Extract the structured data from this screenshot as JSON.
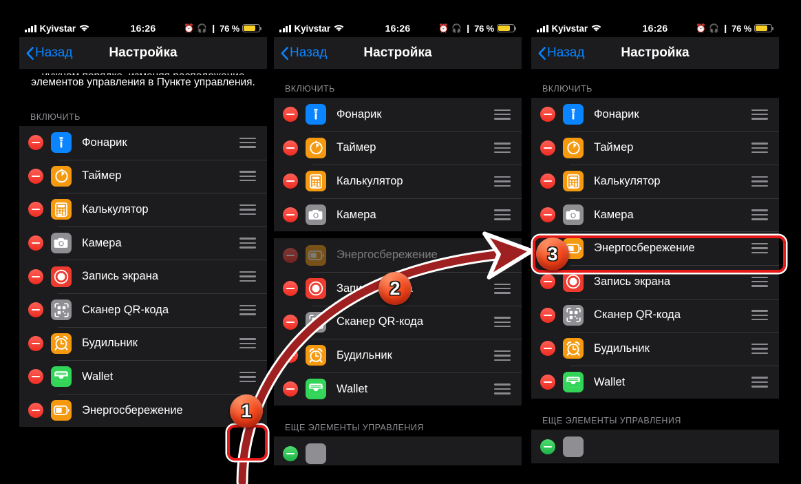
{
  "statusbar": {
    "carrier": "Kyivstar",
    "time": "16:26",
    "alarm_glyph": "⏰",
    "headphones_glyph": "🎧",
    "lock_glyph": "❙",
    "battery_percent": "76 %",
    "battery_level": 76,
    "wifi_icon": "wifi-icon",
    "signal_icon": "cellular-signal-icon"
  },
  "navbar": {
    "back_label": "Назад",
    "title": "Настройка",
    "back_icon": "chevron-left-icon",
    "accent_color": "#0a84ff"
  },
  "panel1": {
    "hint_line_cut": "нужном порядке, изменяя расположение",
    "hint_line1": "элементов управления в Пункте",
    "hint_line2": "управления.",
    "section_header": "ВКЛЮЧИТЬ"
  },
  "panel2": {
    "section_header": "ВКЛЮЧИТЬ",
    "more_header": "ЕЩЕ ЭЛЕМЕНТЫ УПРАВЛЕНИЯ"
  },
  "panel3": {
    "section_header": "ВКЛЮЧИТЬ",
    "more_header": "ЕЩЕ ЭЛЕМЕНТЫ УПРАВЛЕНИЯ"
  },
  "rows_panel1": [
    {
      "label": "Фонарик",
      "icon": "flashlight-icon",
      "color": "#0a84ff"
    },
    {
      "label": "Таймер",
      "icon": "timer-icon",
      "color": "#f59a10"
    },
    {
      "label": "Калькулятор",
      "icon": "calculator-icon",
      "color": "#f59a10"
    },
    {
      "label": "Камера",
      "icon": "camera-icon",
      "color": "#8e8e93"
    },
    {
      "label": "Запись экрана",
      "icon": "screenrecord-icon",
      "color": "#ee3b30"
    },
    {
      "label": "Сканер QR-кода",
      "icon": "qrscanner-icon",
      "color": "#8e8e93"
    },
    {
      "label": "Будильник",
      "icon": "alarm-icon",
      "color": "#f59a10"
    },
    {
      "label": "Wallet",
      "icon": "wallet-icon",
      "color": "#32d558"
    },
    {
      "label": "Энергосбережение",
      "icon": "lowpower-icon",
      "color": "#f59a10"
    }
  ],
  "rows_panel2": [
    {
      "label": "Фонарик",
      "icon": "flashlight-icon",
      "color": "#0a84ff",
      "dragging": false
    },
    {
      "label": "Таймер",
      "icon": "timer-icon",
      "color": "#f59a10",
      "dragging": false
    },
    {
      "label": "Калькулятор",
      "icon": "calculator-icon",
      "color": "#f59a10",
      "dragging": false
    },
    {
      "label": "Камера",
      "icon": "camera-icon",
      "color": "#8e8e93",
      "dragging": false
    },
    {
      "label": "Энергосбережение",
      "icon": "lowpower-icon",
      "color": "#f59a10",
      "dragging": true
    },
    {
      "label": "Запись экрана",
      "icon": "screenrecord-icon",
      "color": "#ee3b30",
      "dragging": false
    },
    {
      "label": "Сканер QR-кода",
      "icon": "qrscanner-icon",
      "color": "#8e8e93",
      "dragging": false
    },
    {
      "label": "Будильник",
      "icon": "alarm-icon",
      "color": "#f59a10",
      "dragging": false
    },
    {
      "label": "Wallet",
      "icon": "wallet-icon",
      "color": "#32d558",
      "dragging": false
    }
  ],
  "rows_panel3": [
    {
      "label": "Фонарик",
      "icon": "flashlight-icon",
      "color": "#0a84ff"
    },
    {
      "label": "Таймер",
      "icon": "timer-icon",
      "color": "#f59a10"
    },
    {
      "label": "Калькулятор",
      "icon": "calculator-icon",
      "color": "#f59a10"
    },
    {
      "label": "Камера",
      "icon": "camera-icon",
      "color": "#8e8e93"
    },
    {
      "label": "Энергосбережение",
      "icon": "lowpower-icon",
      "color": "#f59a10"
    },
    {
      "label": "Запись экрана",
      "icon": "screenrecord-icon",
      "color": "#ee3b30"
    },
    {
      "label": "Сканер QR-кода",
      "icon": "qrscanner-icon",
      "color": "#8e8e93"
    },
    {
      "label": "Будильник",
      "icon": "alarm-icon",
      "color": "#f59a10"
    },
    {
      "label": "Wallet",
      "icon": "wallet-icon",
      "color": "#32d558"
    }
  ],
  "annotations": {
    "badge1": "1",
    "badge2": "2",
    "badge3": "3",
    "arrow_color": "#9e2020",
    "highlight_color": "#e81919"
  }
}
